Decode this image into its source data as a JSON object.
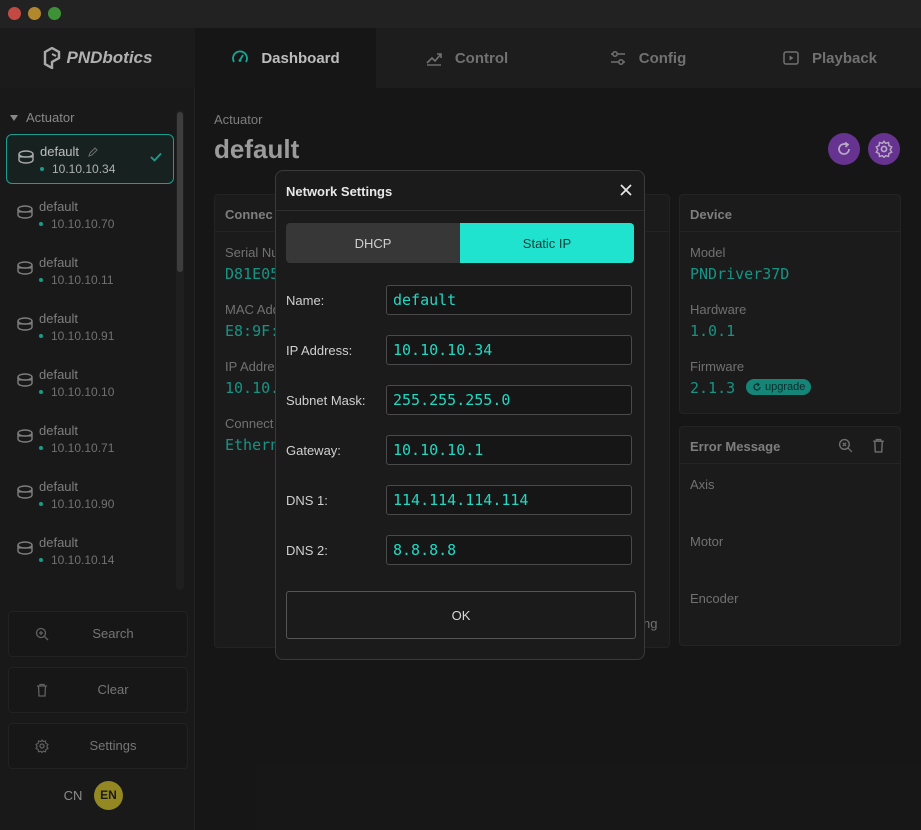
{
  "nav": {
    "logo": "PNDbotics",
    "tabs": [
      {
        "label": "Dashboard",
        "active": true,
        "icon": "gauge-icon"
      },
      {
        "label": "Control",
        "icon": "trend-icon"
      },
      {
        "label": "Config",
        "icon": "sliders-icon"
      },
      {
        "label": "Playback",
        "icon": "play-icon"
      }
    ]
  },
  "sidebar": {
    "header": "Actuator",
    "devices": [
      {
        "name": "default",
        "ip": "10.10.10.34",
        "selected": true
      },
      {
        "name": "default",
        "ip": "10.10.10.70"
      },
      {
        "name": "default",
        "ip": "10.10.10.11"
      },
      {
        "name": "default",
        "ip": "10.10.10.91"
      },
      {
        "name": "default",
        "ip": "10.10.10.10"
      },
      {
        "name": "default",
        "ip": "10.10.10.71"
      },
      {
        "name": "default",
        "ip": "10.10.10.90"
      },
      {
        "name": "default",
        "ip": "10.10.10.14"
      }
    ],
    "buttons": {
      "search": "Search",
      "clear": "Clear",
      "settings": "Settings"
    },
    "lang": {
      "cn": "CN",
      "en": "EN"
    }
  },
  "main": {
    "label": "Actuator",
    "title": "default",
    "connection": {
      "header": "Connec",
      "serial_label": "Serial Nu",
      "serial_value": "D81E05",
      "mac_label": "MAC Add",
      "mac_value": "E8:9F:",
      "ip_label": "IP Addre",
      "ip_value": "10.10.",
      "conn_label": "Connect",
      "conn_value": "Ethern",
      "trailing": "ng"
    },
    "device": {
      "header": "Device",
      "model_label": "Model",
      "model_value": "PNDriver37D",
      "hardware_label": "Hardware",
      "hardware_value": "1.0.1",
      "firmware_label": "Firmware",
      "firmware_value": "2.1.3",
      "upgrade_label": "upgrade"
    },
    "error": {
      "header": "Error Message",
      "axis_label": "Axis",
      "motor_label": "Motor",
      "encoder_label": "Encoder"
    }
  },
  "dialog": {
    "title": "Network Settings",
    "mode_dhcp": "DHCP",
    "mode_static": "Static IP",
    "fields": {
      "name": {
        "label": "Name:",
        "value": "default"
      },
      "ip": {
        "label": "IP Address:",
        "value": "10.10.10.34"
      },
      "subnet": {
        "label": "Subnet Mask:",
        "value": "255.255.255.0"
      },
      "gateway": {
        "label": "Gateway:",
        "value": "10.10.10.1"
      },
      "dns1": {
        "label": "DNS 1:",
        "value": "114.114.114.114"
      },
      "dns2": {
        "label": "DNS 2:",
        "value": "8.8.8.8"
      }
    },
    "ok": "OK"
  },
  "colors": {
    "accent": "#1fe3cf",
    "purple": "#7d3fb0",
    "language": "#b5a72a"
  }
}
